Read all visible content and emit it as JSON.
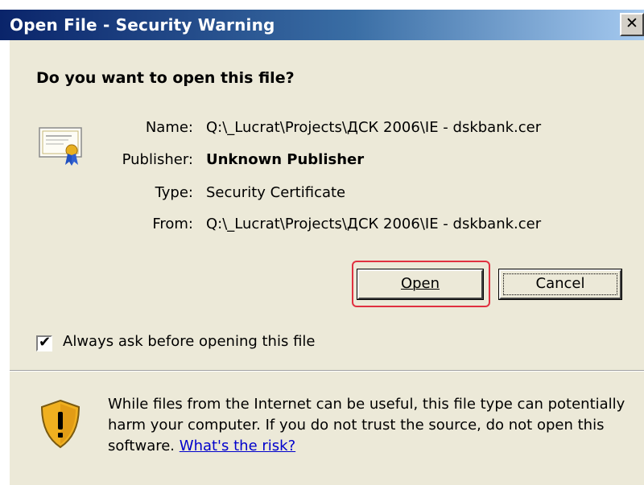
{
  "window": {
    "title": "Open File - Security Warning",
    "close_glyph": "✕"
  },
  "dialog": {
    "heading": "Do you want to open this file?",
    "fields": {
      "name": {
        "label": "Name:",
        "value": "Q:\\_Lucrat\\Projects\\ДСК 2006\\IE - dskbank.cer"
      },
      "publisher": {
        "label": "Publisher:",
        "value": "Unknown Publisher"
      },
      "type": {
        "label": "Type:",
        "value": "Security Certificate"
      },
      "from": {
        "label": "From:",
        "value": "Q:\\_Lucrat\\Projects\\ДСК 2006\\IE - dskbank.cer"
      }
    },
    "buttons": {
      "open": "Open",
      "cancel": "Cancel"
    },
    "checkbox": {
      "label": "Always ask before opening this file",
      "checked": true
    },
    "warning": {
      "text": "While files from the Internet can be useful, this file type can potentially harm your computer. If you do not trust the source, do not open this software.",
      "link": "What's the risk?"
    },
    "icons": {
      "file": "certificate-icon",
      "warning": "shield-warning-icon",
      "check": "checkmark-icon"
    },
    "colors": {
      "titlebar_start": "#0a246a",
      "titlebar_end": "#a6caf0",
      "highlight": "#e03040",
      "link": "#0000cc"
    }
  }
}
